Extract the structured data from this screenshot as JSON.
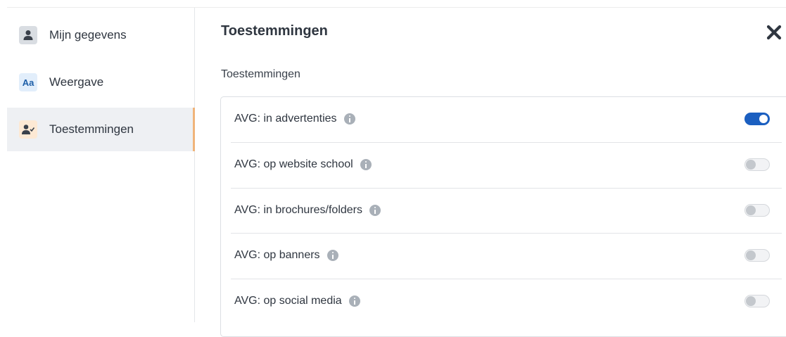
{
  "sidebar": {
    "items": [
      {
        "label": "Mijn gegevens",
        "icon": "user-icon"
      },
      {
        "label": "Weergave",
        "icon": "text-size-icon",
        "icon_text": "Aa"
      },
      {
        "label": "Toestemmingen",
        "icon": "user-check-icon",
        "active": true
      }
    ]
  },
  "main": {
    "title": "Toestemmingen",
    "section_label": "Toestemmingen",
    "close_icon": "close-icon",
    "permissions": [
      {
        "label": "AVG: in advertenties",
        "enabled": true
      },
      {
        "label": "AVG: op website school",
        "enabled": false
      },
      {
        "label": "AVG: in brochures/folders",
        "enabled": false
      },
      {
        "label": "AVG: op banners",
        "enabled": false
      },
      {
        "label": "AVG: op social media",
        "enabled": false
      }
    ]
  },
  "colors": {
    "accent": "#1b5fc0",
    "active_indicator": "#f0b47a",
    "active_bg": "#eef0f3"
  }
}
